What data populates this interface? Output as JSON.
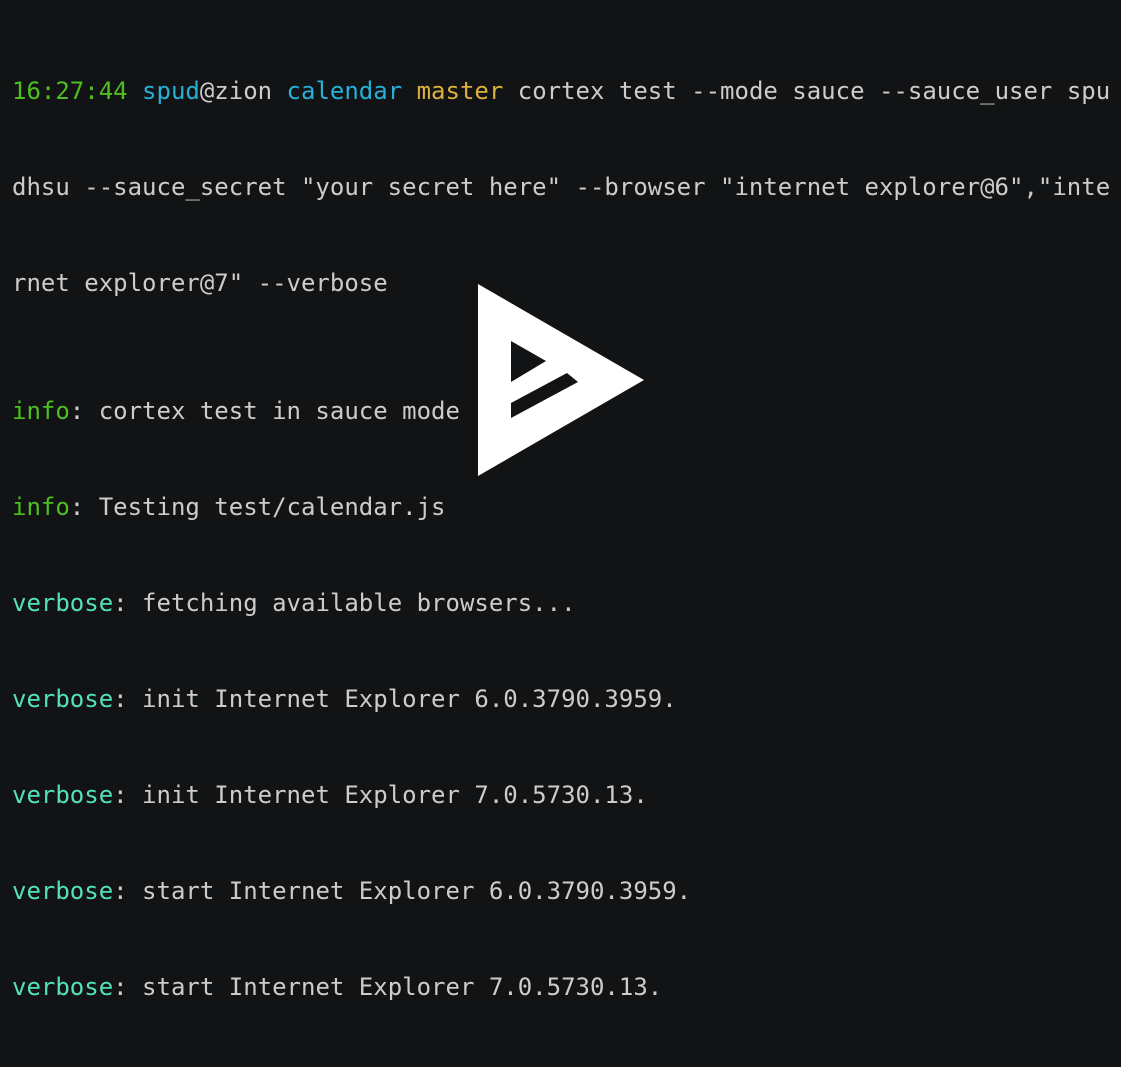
{
  "colors": {
    "background": "#121314",
    "text": "#cccccc",
    "time": "#4ebf22",
    "user": "#26b0d7",
    "dir": "#26b0d7",
    "branch": "#ddaf3c",
    "info": "#4ebf22",
    "verbose": "#54e1b9",
    "play_icon": "#ffffff"
  },
  "icons": {
    "play": "asciinema-play-icon"
  },
  "prompt": {
    "time": "16:27:44",
    "user": "spud",
    "at_host": "@zion",
    "dir": "calendar",
    "branch": "master",
    "command_line_1": "cortex test --mode sauce --sauce_user spu",
    "command_line_2": "dhsu --sauce_secret \"your secret here\" --browser \"internet explorer@6\",\"inte",
    "command_line_3": "rnet explorer@7\" --verbose"
  },
  "log": [
    {
      "level": "info",
      "message": ": cortex test in sauce mode"
    },
    {
      "level": "info",
      "message": ": Testing test/calendar.js"
    },
    {
      "level": "verbose",
      "message": ": fetching available browsers..."
    },
    {
      "level": "verbose",
      "message": ": init Internet Explorer 6.0.3790.3959."
    },
    {
      "level": "verbose",
      "message": ": init Internet Explorer 7.0.5730.13."
    },
    {
      "level": "verbose",
      "message": ": start Internet Explorer 6.0.3790.3959."
    },
    {
      "level": "verbose",
      "message": ": start Internet Explorer 7.0.5730.13."
    }
  ]
}
